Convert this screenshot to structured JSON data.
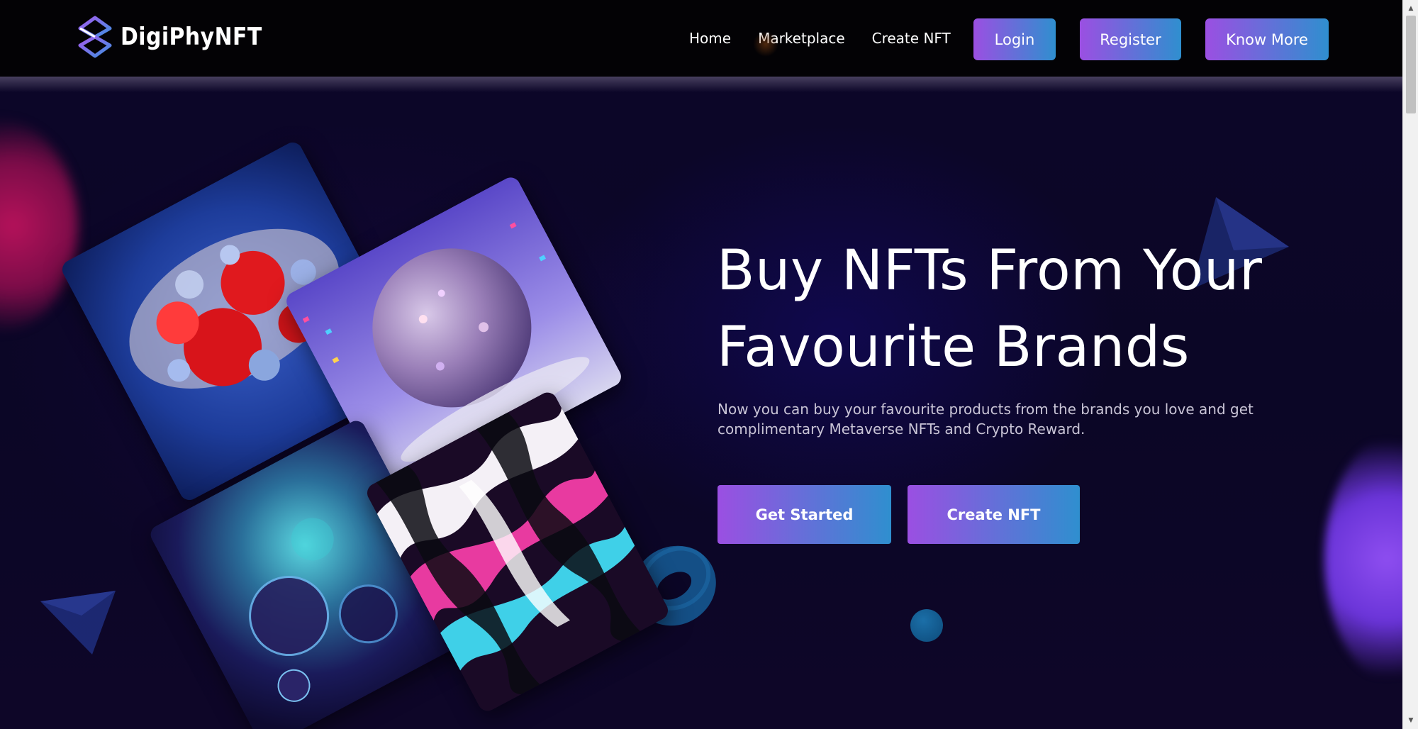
{
  "brand": {
    "name": "DigiPhyNFT",
    "logo_icon": "layers-diamond-logo-icon"
  },
  "nav": {
    "links": [
      "Home",
      "Marketplace",
      "Create NFT"
    ],
    "buttons": [
      "Login",
      "Register",
      "Know More"
    ]
  },
  "hero": {
    "title": "Buy NFTs From Your Favourite Brands",
    "description": "Now you can buy your favourite products from the brands you love and get complimentary Metaverse NFTs and Crypto Reward.",
    "cta_primary": "Get Started",
    "cta_secondary": "Create NFT"
  },
  "artworks": [
    {
      "name": "red-fluid-art",
      "description": "red and blue fluid bubbles"
    },
    {
      "name": "sphere-art",
      "description": "mosaic sphere in neon room"
    },
    {
      "name": "teal-bubble-art",
      "description": "teal glass bubbles"
    },
    {
      "name": "pink-marble-art",
      "description": "pink black marbled paint"
    }
  ],
  "colors": {
    "background": "#0b0626",
    "navbar": "#030205",
    "button_gradient_start": "#9b4fe2",
    "button_gradient_end": "#2f8fcf",
    "text_primary": "#ffffff",
    "text_secondary": "#c9c4d6"
  }
}
